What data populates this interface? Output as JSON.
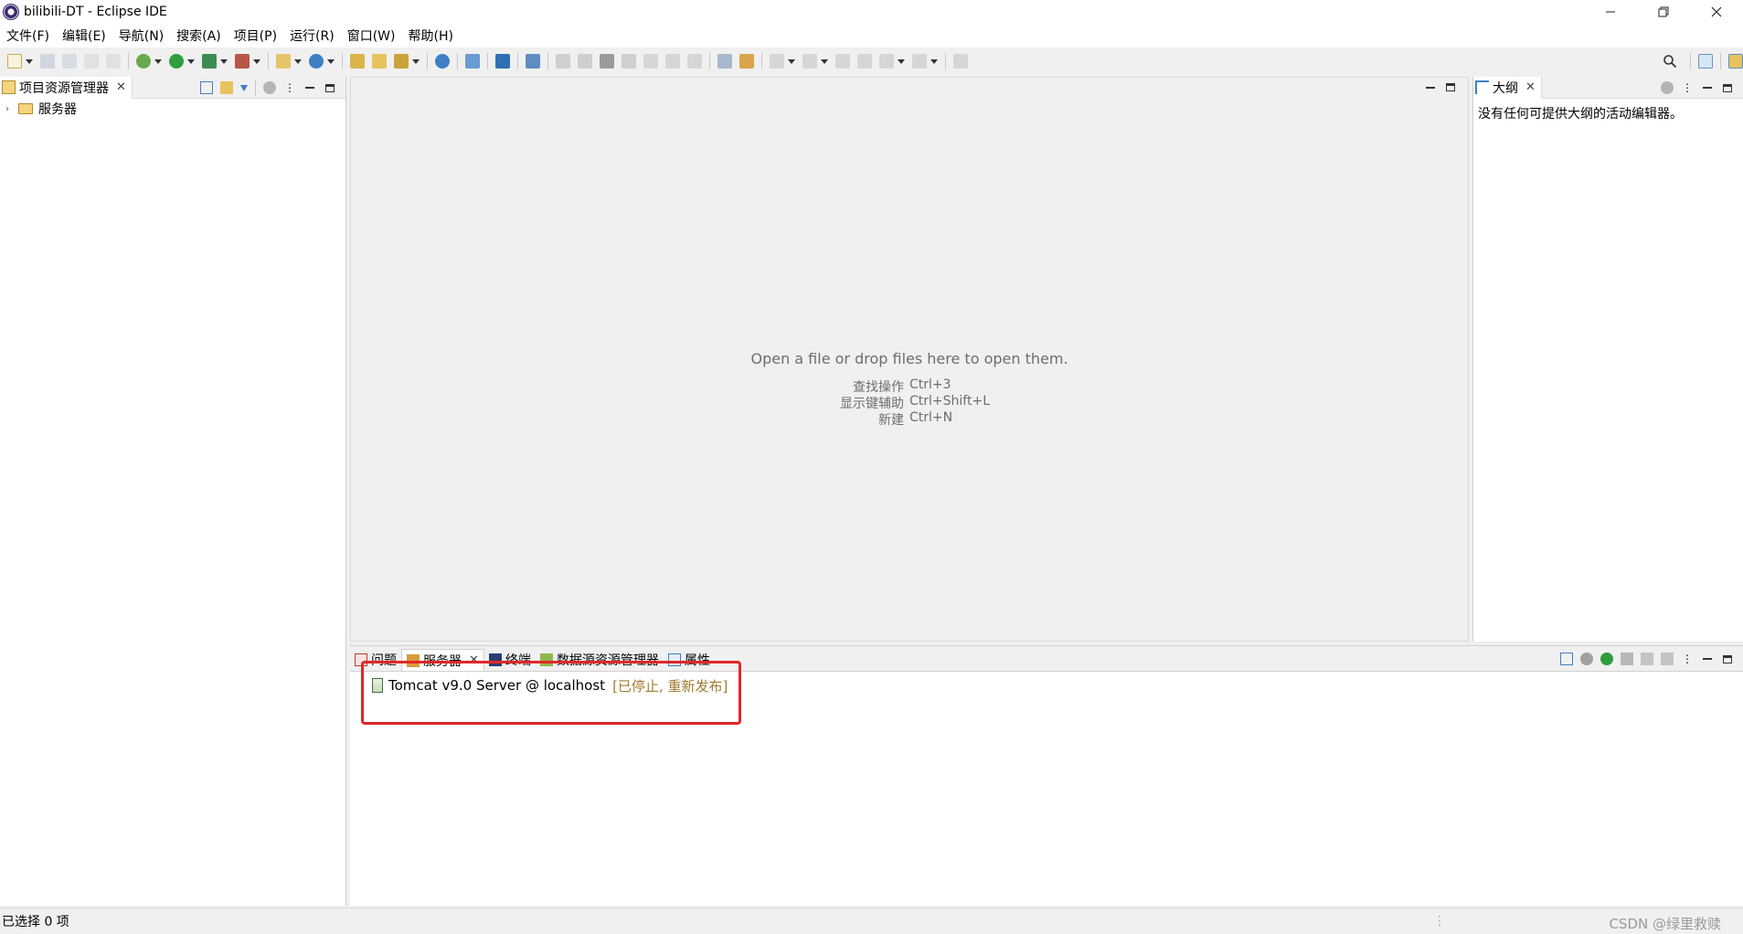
{
  "window": {
    "title": "bilibili-DT - Eclipse IDE",
    "controls": [
      "minimize-icon",
      "restore-icon",
      "close-icon"
    ]
  },
  "menu": [
    "文件(F)",
    "编辑(E)",
    "导航(N)",
    "搜索(A)",
    "项目(P)",
    "运行(R)",
    "窗口(W)",
    "帮助(H)"
  ],
  "toolbar": {
    "icons": [
      "new-icon",
      "save-icon",
      "save-all-icon",
      "undo-icon",
      "redo-icon",
      "debug-icon",
      "run-icon",
      "coverage-icon",
      "external-tools-icon",
      "new-server-icon",
      "new-java-class-icon",
      "open-type-icon",
      "open-folder-icon",
      "open-task-icon",
      "web-browser-icon",
      "search-icon",
      "toggle-breadcrumb-icon",
      "resume-icon",
      "suspend-icon",
      "terminate-icon",
      "disconnect-icon",
      "step-into-icon",
      "step-over-icon",
      "step-return-icon",
      "drop-to-frame-icon",
      "use-step-filters-icon",
      "next-annotation-icon",
      "previous-annotation-icon",
      "last-edit-icon",
      "back-icon",
      "forward-icon",
      "pin-editor-icon"
    ],
    "right_icons": [
      "search-icon",
      "open-perspective-icon",
      "java-ee-perspective-icon"
    ],
    "accent": "#2f7bc8"
  },
  "left_panel": {
    "tab_label": "项目资源管理器",
    "tree": [
      {
        "label": "服务器",
        "expanded": false
      }
    ]
  },
  "editor": {
    "hint": "Open a file or drop files here to open them.",
    "shortcuts": [
      {
        "label": "查找操作",
        "key": "Ctrl+3"
      },
      {
        "label": "显示键辅助",
        "key": "Ctrl+Shift+L"
      },
      {
        "label": "新建",
        "key": "Ctrl+N"
      }
    ]
  },
  "outline": {
    "tab_label": "大纲",
    "message": "没有任何可提供大纲的活动编辑器。"
  },
  "bottom": {
    "tabs": [
      {
        "label": "问题",
        "icon": "problems-icon",
        "active": false
      },
      {
        "label": "服务器",
        "icon": "servers-icon",
        "active": true
      },
      {
        "label": "终端",
        "icon": "terminal-icon",
        "active": false
      },
      {
        "label": "数据源资源管理器",
        "icon": "data-source-icon",
        "active": false
      },
      {
        "label": "属性",
        "icon": "properties-icon",
        "active": false
      }
    ],
    "server": {
      "name": "Tomcat v9.0 Server @ localhost",
      "status": "[已停止, 重新发布]",
      "status_color": "#a07a2e"
    },
    "highlight_color": "#e02828"
  },
  "status_bar": {
    "text": "已选择 0 项",
    "watermark": "CSDN @绿里救赎"
  }
}
